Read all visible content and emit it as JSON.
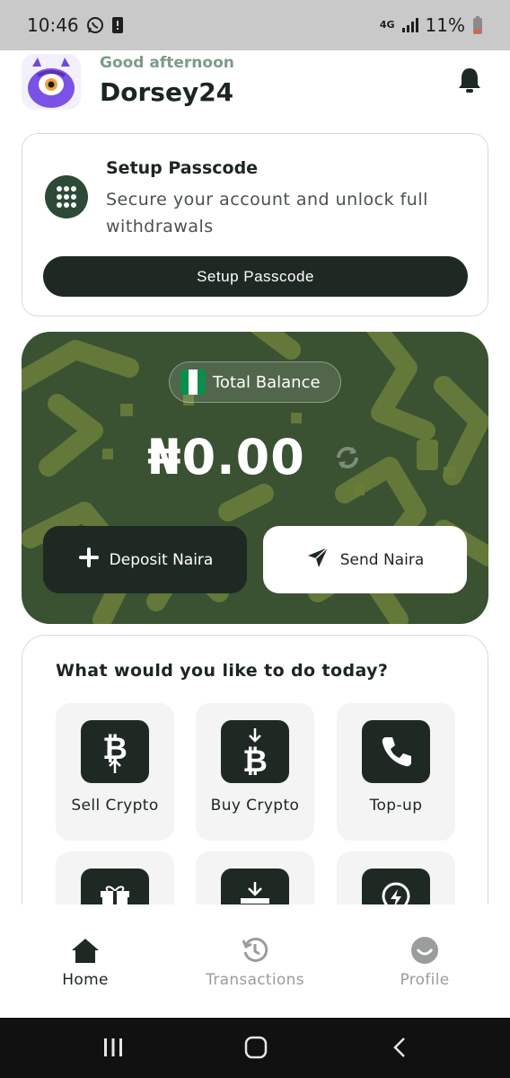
{
  "status_bar": {
    "time": "10:46",
    "network": "4G",
    "battery": "11%"
  },
  "header": {
    "greeting": "Good afternoon",
    "username": "Dorsey24",
    "avatar_icon": "monster-avatar-icon",
    "bell_icon": "bell-icon"
  },
  "passcode_card": {
    "title": "Setup Passcode",
    "description": "Secure your account and unlock full withdrawals",
    "button_label": "Setup Passcode",
    "icon": "keypad-icon"
  },
  "balance_card": {
    "label": "Total Balance",
    "amount": "₦0.00",
    "deposit_label": "Deposit Naira",
    "send_label": "Send Naira",
    "flag_colors": [
      "#0a8f4a",
      "#ffffff",
      "#0a8f4a"
    ]
  },
  "actions": {
    "title": "What would you like to do today?",
    "items": [
      {
        "label": "Sell Crypto",
        "icon": "sell-bitcoin-icon"
      },
      {
        "label": "Buy Crypto",
        "icon": "buy-bitcoin-icon"
      },
      {
        "label": "Top-up",
        "icon": "phone-icon"
      },
      {
        "label": "",
        "icon": "gift-card-icon"
      },
      {
        "label": "",
        "icon": "download-gift-icon"
      },
      {
        "label": "",
        "icon": "electricity-icon"
      }
    ]
  },
  "bottom_nav": {
    "items": [
      {
        "label": "Home",
        "icon": "home-icon",
        "active": true
      },
      {
        "label": "Transactions",
        "icon": "history-icon",
        "active": false
      },
      {
        "label": "Profile",
        "icon": "profile-icon",
        "active": false
      }
    ]
  },
  "colors": {
    "primary_dark": "#1f2924",
    "card_green": "#3a5132",
    "muted": "#9a9d9b",
    "greeting_green": "#7c9c88"
  }
}
